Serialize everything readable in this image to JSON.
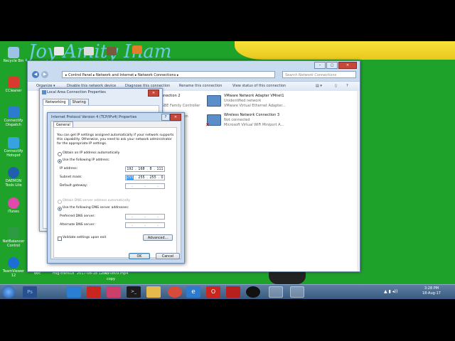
{
  "desktop": {
    "icons": [
      {
        "label": "Recycle Bin",
        "color": "#9cc3e6"
      },
      {
        "label": "CCleaner",
        "color": "#d83b2e"
      },
      {
        "label": "Connectify Dispatch",
        "color": "#2d7bd1"
      },
      {
        "label": "Connectify Hotspot",
        "color": "#36a3e0"
      },
      {
        "label": "DAEMON Tools Lite",
        "color": "#1f5fae"
      },
      {
        "label": "iTunes",
        "color": "#e04aa8"
      },
      {
        "label": "NetBalancer Control",
        "color": "#2c9b43"
      },
      {
        "label": "TeamViewer 12",
        "color": "#1d6ed3"
      }
    ],
    "bottom_labels": [
      "bbc",
      "mig-trans18",
      "2017-08-18 12:43",
      "20170809.mp4",
      "copy"
    ]
  },
  "explorer": {
    "address": "▸ Control Panel ▸ Network and Internet ▸ Network Connections ▸",
    "search_placeholder": "Search Network Connections",
    "toolbar": [
      "Organize ▾",
      "Disable this network device",
      "Diagnose this connection",
      "Rename this connection",
      "View status of this connection"
    ],
    "connections": [
      {
        "name": "nnection 2",
        "status": "",
        "adapter": "GBE Family Controller"
      },
      {
        "name": "VMware Network Adapter VMnet1",
        "status": "Unidentified network",
        "adapter": "VMware Virtual Ethernet Adapter..."
      },
      {
        "name": "",
        "status": "",
        "adapter": "ion"
      },
      {
        "name": "Wireless Network Connection 3",
        "status": "Not connected",
        "adapter": "Microsoft Virtual WiFi Miniport A..."
      }
    ],
    "window_buttons": {
      "min": "–",
      "max": "▢",
      "close": "✕"
    }
  },
  "lan_props": {
    "title": "Local Area Connection Properties",
    "tabs": [
      "Networking",
      "Sharing"
    ],
    "close": "✕"
  },
  "tcpip": {
    "title": "Internet Protocol Version 4 (TCP/IPv4) Properties",
    "help_btn": "?",
    "close_btn": "✕",
    "tab": "General",
    "intro": [
      "You can get IP settings assigned automatically if your network supports",
      "this capability. Otherwise, you need to ask your network administrator",
      "for the appropriate IP settings."
    ],
    "radio_auto_ip": "Obtain an IP address automatically",
    "radio_manual_ip": "Use the following IP address:",
    "ip_label": "IP address:",
    "ip_value": [
      "192",
      "168",
      "8",
      "111"
    ],
    "mask_label": "Subnet mask:",
    "mask_value": [
      "255",
      "255",
      "255",
      "0"
    ],
    "gateway_label": "Default gateway:",
    "radio_auto_dns": "Obtain DNS server address automatically",
    "radio_manual_dns": "Use the following DNS server addresses:",
    "pref_dns_label": "Preferred DNS server:",
    "alt_dns_label": "Alternate DNS server:",
    "validate_label": "Validate settings upon exit",
    "advanced_btn": "Advanced...",
    "ok_btn": "OK",
    "cancel_btn": "Cancel"
  },
  "taskbar": {
    "time": "3:28 PM",
    "date": "18-Aug-17",
    "apps": [
      {
        "name": "ps",
        "color": "#2a4f8e",
        "glyph": "Ps"
      },
      {
        "name": "shark",
        "color": "#2b7fd3",
        "glyph": ""
      },
      {
        "name": "acrobat",
        "color": "#c8261f",
        "glyph": ""
      },
      {
        "name": "screen",
        "color": "#cc3f6c",
        "glyph": ""
      },
      {
        "name": "cmd",
        "color": "#1b1b1b",
        "glyph": ">_"
      },
      {
        "name": "folder",
        "color": "#e5b94c",
        "glyph": ""
      },
      {
        "name": "chrome",
        "color": "#d64b3b",
        "glyph": ""
      },
      {
        "name": "ie",
        "color": "#2d7bd1",
        "glyph": "e"
      },
      {
        "name": "opera",
        "color": "#c8261f",
        "glyph": "O"
      },
      {
        "name": "ruby",
        "color": "#b81f1f",
        "glyph": ""
      },
      {
        "name": "qq",
        "color": "#111",
        "glyph": ""
      },
      {
        "name": "network",
        "color": "#7cb2e6",
        "glyph": ""
      },
      {
        "name": "explorer",
        "color": "#bcd3ec",
        "glyph": ""
      }
    ]
  }
}
